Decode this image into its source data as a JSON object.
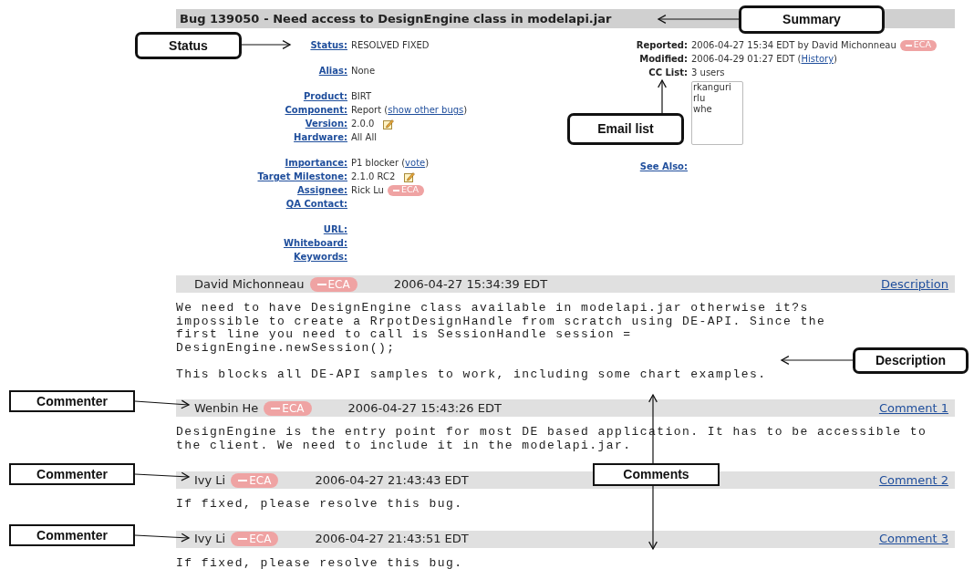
{
  "summary": {
    "bug_link": "Bug 139050",
    "title": "- Need access to DesignEngine class in modelapi.jar"
  },
  "fields_left": [
    [
      {
        "label": "Status:",
        "value": "RESOLVED FIXED",
        "editable": false
      }
    ],
    [
      {
        "label": "Alias:",
        "value": "None",
        "editable": false
      }
    ],
    [
      {
        "label": "Product:",
        "value": "BIRT",
        "editable": false
      },
      {
        "label": "Component:",
        "value": "Report (",
        "link": "show other bugs",
        "after": ")",
        "editable": false
      },
      {
        "label": "Version:",
        "value": "2.0.0",
        "editable": true
      },
      {
        "label": "Hardware:",
        "value": "All All",
        "editable": false
      }
    ],
    [
      {
        "label": "Importance:",
        "value": "P1 blocker (",
        "link": "vote",
        "after": ")",
        "editable": false
      },
      {
        "label": "Target Milestone:",
        "value": "2.1.0 RC2",
        "editable": true
      },
      {
        "label": "Assignee:",
        "value": "Rick Lu",
        "badge": "ECA",
        "editable": false
      },
      {
        "label": "QA Contact:",
        "editable": false
      }
    ],
    [
      {
        "label": "URL:",
        "editable": false
      },
      {
        "label": "Whiteboard:",
        "editable": false
      },
      {
        "label": "Keywords:",
        "editable": false
      }
    ]
  ],
  "fields_right": [
    {
      "label": "Reported:",
      "value": "2006-04-27 15:34 EDT by David Michonneau",
      "badge": "ECA"
    },
    {
      "label": "Modified:",
      "value": "2006-04-29 01:27 EDT (",
      "link": "History",
      "after": ")"
    },
    {
      "label": "CC List:",
      "value": "3 users"
    }
  ],
  "cc_list": [
    "rkanguri",
    "rlu",
    "whe"
  ],
  "see_also": {
    "label": "See Also:"
  },
  "comments": [
    {
      "author": "David Michonneau",
      "badge": "ECA",
      "date": "2006-04-27 15:34:39 EDT",
      "link": "Description",
      "paragraphs": [
        "We need to have DesignEngine class available in modelapi.jar otherwise it?s\nimpossible to create a RrpotDesignHandle from scratch using DE-API. Since the\nfirst line you need to call is SessionHandle session =\nDesignEngine.newSession();",
        "This blocks all DE-API samples to work, including some chart examples."
      ]
    },
    {
      "author": "Wenbin He",
      "badge": "ECA",
      "date": "2006-04-27 15:43:26 EDT",
      "link": "Comment 1",
      "paragraphs": [
        "DesignEngine is the entry point for most DE based application. It has to be accessible to\nthe client. We need to include it in the modelapi.jar."
      ]
    },
    {
      "author": "Ivy Li",
      "badge": "ECA",
      "date": "2006-04-27 21:43:43 EDT",
      "link": "Comment 2",
      "paragraphs": [
        "If fixed, please resolve this bug."
      ]
    },
    {
      "author": "Ivy Li",
      "badge": "ECA",
      "date": "2006-04-27 21:43:51 EDT",
      "link": "Comment 3",
      "paragraphs": [
        "If fixed, please resolve this bug."
      ]
    }
  ],
  "annotations": [
    {
      "text": "Summary",
      "kind": "rounded"
    },
    {
      "text": "Status",
      "kind": "rounded"
    },
    {
      "text": "Email list",
      "kind": "rounded"
    },
    {
      "text": "Description",
      "kind": "rounded"
    },
    {
      "text": "Commenter",
      "kind": "square"
    },
    {
      "text": "Commenter",
      "kind": "square"
    },
    {
      "text": "Commenter",
      "kind": "square"
    },
    {
      "text": "Comments",
      "kind": "square"
    }
  ]
}
